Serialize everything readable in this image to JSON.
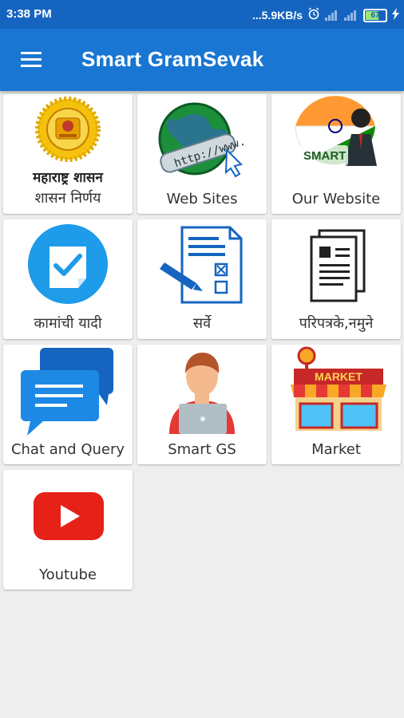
{
  "status_bar": {
    "time": "3:38 PM",
    "network_speed": "...5.9KB/s",
    "battery": "67"
  },
  "app_bar": {
    "menu_icon": "hamburger-menu-icon",
    "title": "Smart GramSevak"
  },
  "tiles": [
    {
      "label": "शासन निर्णय",
      "icon": "maharashtra-emblem-icon",
      "icon_text": "महाराष्ट्र शासन"
    },
    {
      "label": "Web Sites",
      "icon": "globe-www-icon",
      "icon_text": "http://www."
    },
    {
      "label": "Our Website",
      "icon": "smart-gramsevak-logo-icon",
      "icon_text": "SMART"
    },
    {
      "label": "कामांची यादी",
      "icon": "checklist-icon"
    },
    {
      "label": "सर्वे",
      "icon": "survey-form-icon"
    },
    {
      "label": "परिपत्रके,नमुने",
      "icon": "documents-icon"
    },
    {
      "label": "Chat and Query",
      "icon": "chat-bubbles-icon"
    },
    {
      "label": "Smart GS",
      "icon": "person-laptop-icon"
    },
    {
      "label": "Market",
      "icon": "market-shop-icon",
      "icon_text": "MARKET"
    },
    {
      "label": "Youtube",
      "icon": "youtube-icon"
    }
  ],
  "colors": {
    "status_bar": "#1565c0",
    "app_bar": "#1976d2",
    "background": "#eeeeee"
  }
}
